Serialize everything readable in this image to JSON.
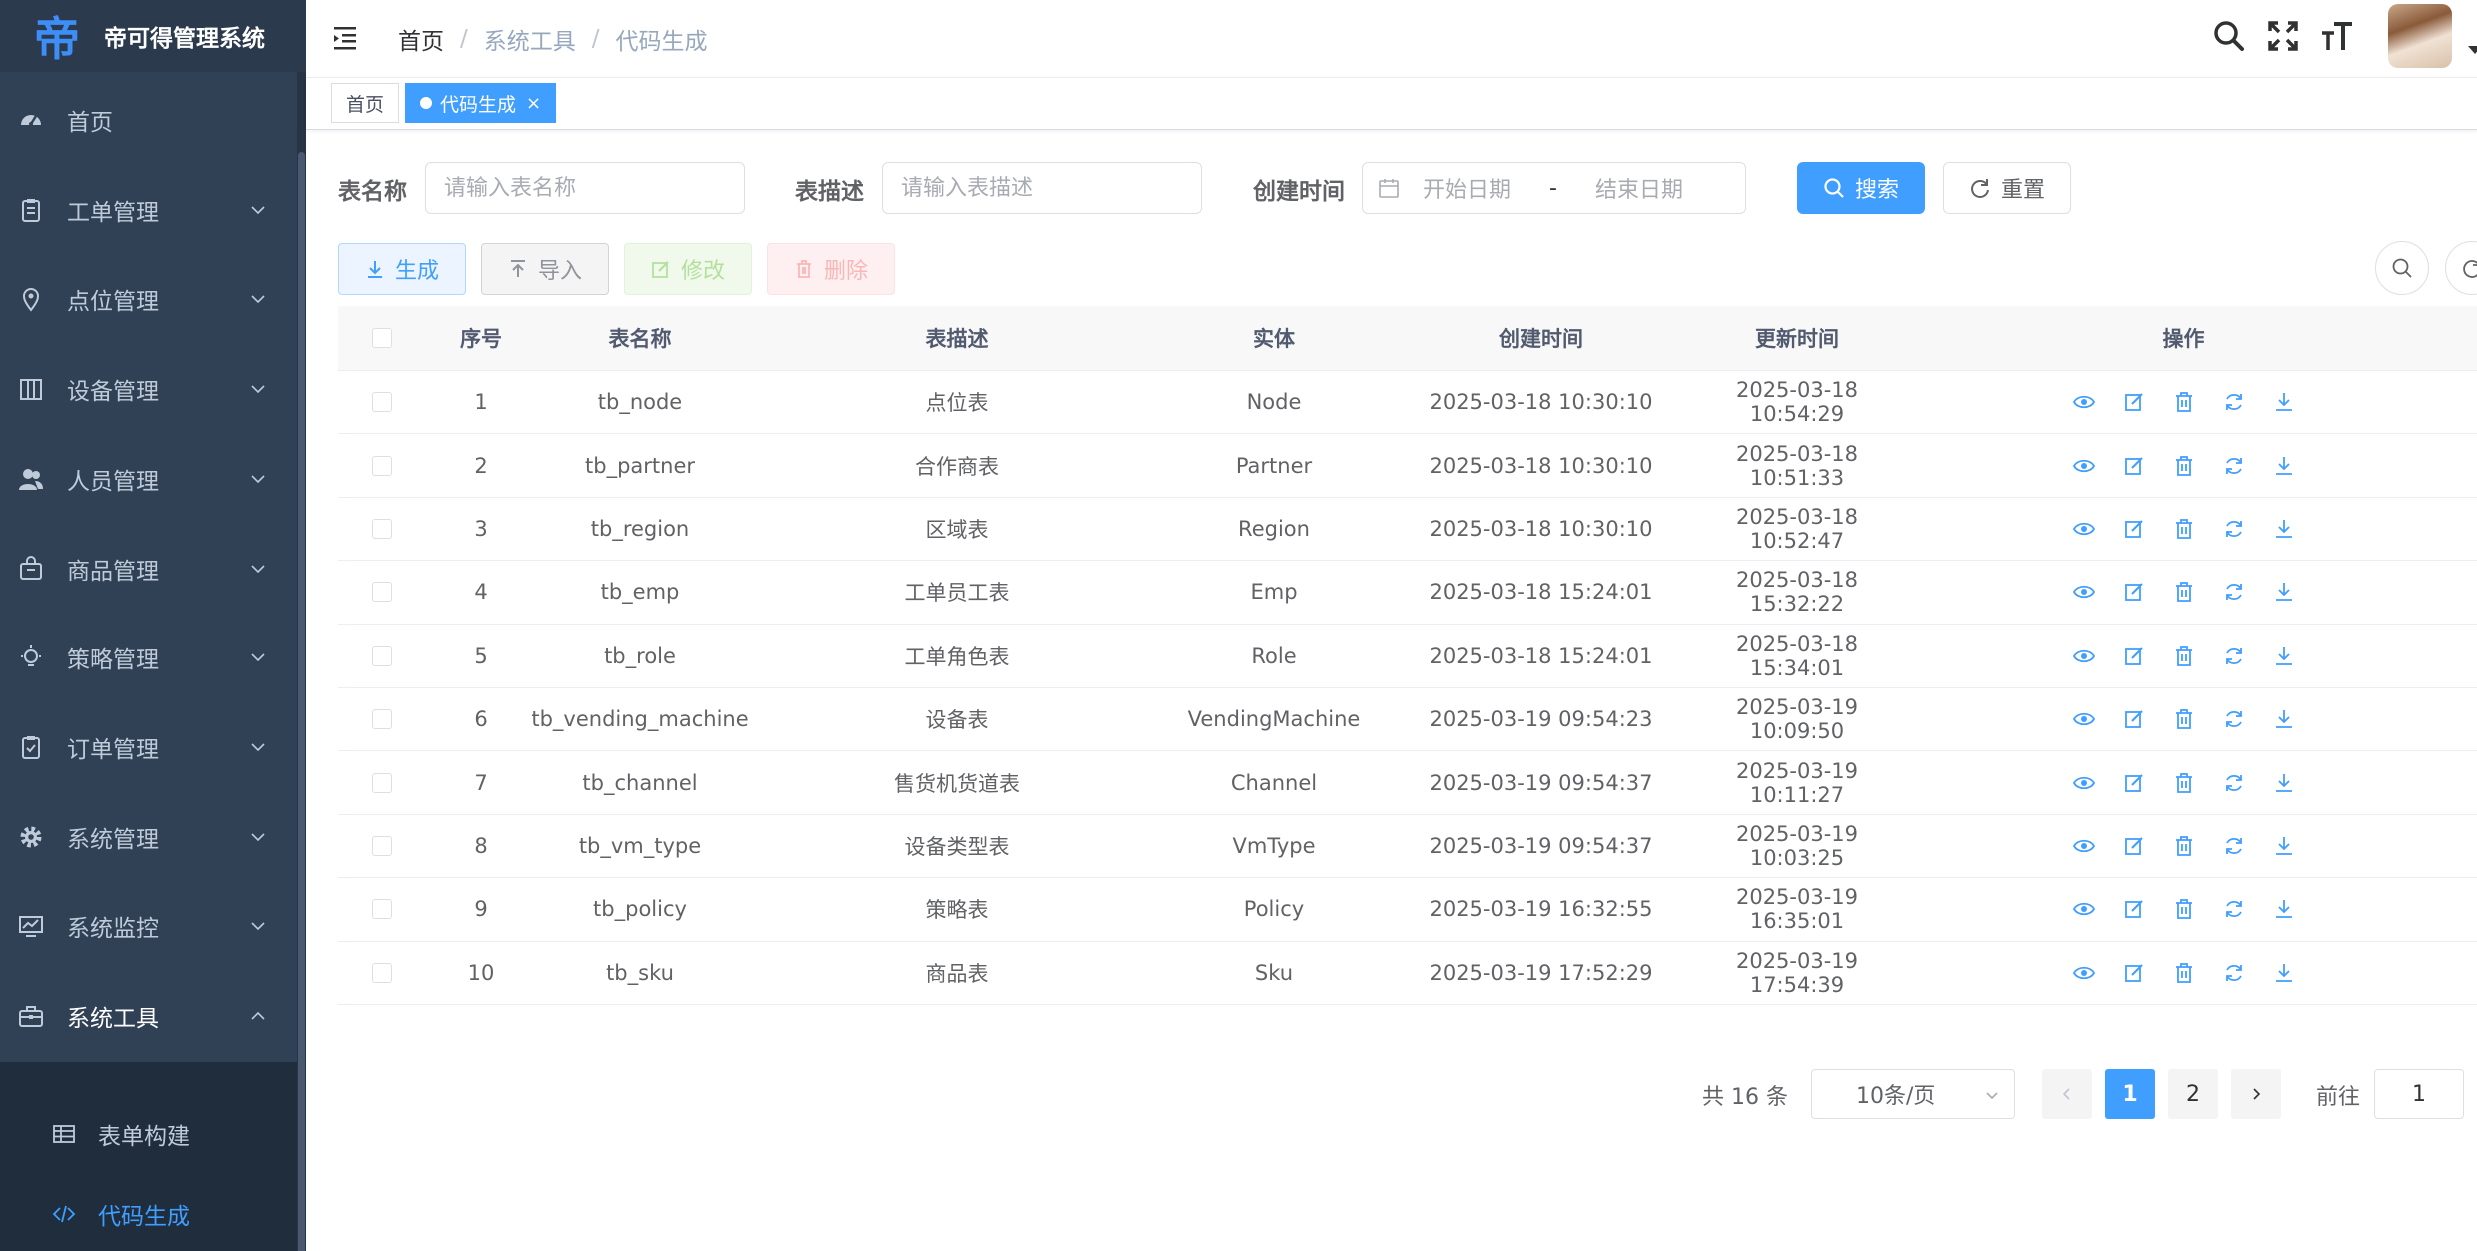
{
  "app": {
    "title": "帝可得管理系统",
    "logo_glyph": "帝"
  },
  "sidebar": {
    "items": [
      {
        "label": "首页",
        "icon": "dashboard-icon"
      },
      {
        "label": "工单管理",
        "icon": "clipboard-icon"
      },
      {
        "label": "点位管理",
        "icon": "location-pin-icon"
      },
      {
        "label": "设备管理",
        "icon": "columns-icon"
      },
      {
        "label": "人员管理",
        "icon": "peoples-icon"
      },
      {
        "label": "商品管理",
        "icon": "shopping-bag-icon"
      },
      {
        "label": "策略管理",
        "icon": "lightbulb-icon"
      },
      {
        "label": "订单管理",
        "icon": "order-check-icon"
      },
      {
        "label": "系统管理",
        "icon": "gear-icon"
      },
      {
        "label": "系统监控",
        "icon": "monitor-chart-icon"
      },
      {
        "label": "系统工具",
        "icon": "toolbox-icon"
      }
    ],
    "sub_items": [
      {
        "label": "表单构建",
        "icon": "grid-table-icon"
      },
      {
        "label": "代码生成",
        "icon": "code-icon"
      }
    ]
  },
  "header": {
    "breadcrumb": [
      "首页",
      "系统工具",
      "代码生成"
    ],
    "separator": "/"
  },
  "tags": {
    "home": "首页",
    "active": "代码生成",
    "close_glyph": "×"
  },
  "search": {
    "table_name_label": "表名称",
    "table_name_placeholder": "请输入表名称",
    "table_desc_label": "表描述",
    "table_desc_placeholder": "请输入表描述",
    "create_time_label": "创建时间",
    "start_date_placeholder": "开始日期",
    "range_separator": "-",
    "end_date_placeholder": "结束日期",
    "search_button": "搜索",
    "reset_button": "重置"
  },
  "toolbar": {
    "generate": "生成",
    "import": "导入",
    "edit": "修改",
    "delete": "删除"
  },
  "table": {
    "columns": [
      "序号",
      "表名称",
      "表描述",
      "实体",
      "创建时间",
      "更新时间",
      "操作"
    ],
    "rows": [
      {
        "idx": "1",
        "name": "tb_node",
        "desc": "点位表",
        "entity": "Node",
        "created": "2025-03-18 10:30:10",
        "updated": "2025-03-18 10:54:29"
      },
      {
        "idx": "2",
        "name": "tb_partner",
        "desc": "合作商表",
        "entity": "Partner",
        "created": "2025-03-18 10:30:10",
        "updated": "2025-03-18 10:51:33"
      },
      {
        "idx": "3",
        "name": "tb_region",
        "desc": "区域表",
        "entity": "Region",
        "created": "2025-03-18 10:30:10",
        "updated": "2025-03-18 10:52:47"
      },
      {
        "idx": "4",
        "name": "tb_emp",
        "desc": "工单员工表",
        "entity": "Emp",
        "created": "2025-03-18 15:24:01",
        "updated": "2025-03-18 15:32:22"
      },
      {
        "idx": "5",
        "name": "tb_role",
        "desc": "工单角色表",
        "entity": "Role",
        "created": "2025-03-18 15:24:01",
        "updated": "2025-03-18 15:34:01"
      },
      {
        "idx": "6",
        "name": "tb_vending_machine",
        "desc": "设备表",
        "entity": "VendingMachine",
        "created": "2025-03-19 09:54:23",
        "updated": "2025-03-19 10:09:50"
      },
      {
        "idx": "7",
        "name": "tb_channel",
        "desc": "售货机货道表",
        "entity": "Channel",
        "created": "2025-03-19 09:54:37",
        "updated": "2025-03-19 10:11:27"
      },
      {
        "idx": "8",
        "name": "tb_vm_type",
        "desc": "设备类型表",
        "entity": "VmType",
        "created": "2025-03-19 09:54:37",
        "updated": "2025-03-19 10:03:25"
      },
      {
        "idx": "9",
        "name": "tb_policy",
        "desc": "策略表",
        "entity": "Policy",
        "created": "2025-03-19 16:32:55",
        "updated": "2025-03-19 16:35:01"
      },
      {
        "idx": "10",
        "name": "tb_sku",
        "desc": "商品表",
        "entity": "Sku",
        "created": "2025-03-19 17:52:29",
        "updated": "2025-03-19 17:54:39"
      }
    ],
    "row_actions": [
      "preview-icon",
      "edit-icon",
      "delete-icon",
      "sync-icon",
      "download-icon"
    ]
  },
  "pagination": {
    "total_text": "共 16 条",
    "page_size": "10条/页",
    "pages": [
      "1",
      "2"
    ],
    "current_page": "1",
    "goto_label": "前往",
    "goto_value": "1"
  },
  "colors": {
    "primary": "#409eff",
    "sidebar_bg": "#304156",
    "submenu_bg": "#1f2d3d"
  }
}
